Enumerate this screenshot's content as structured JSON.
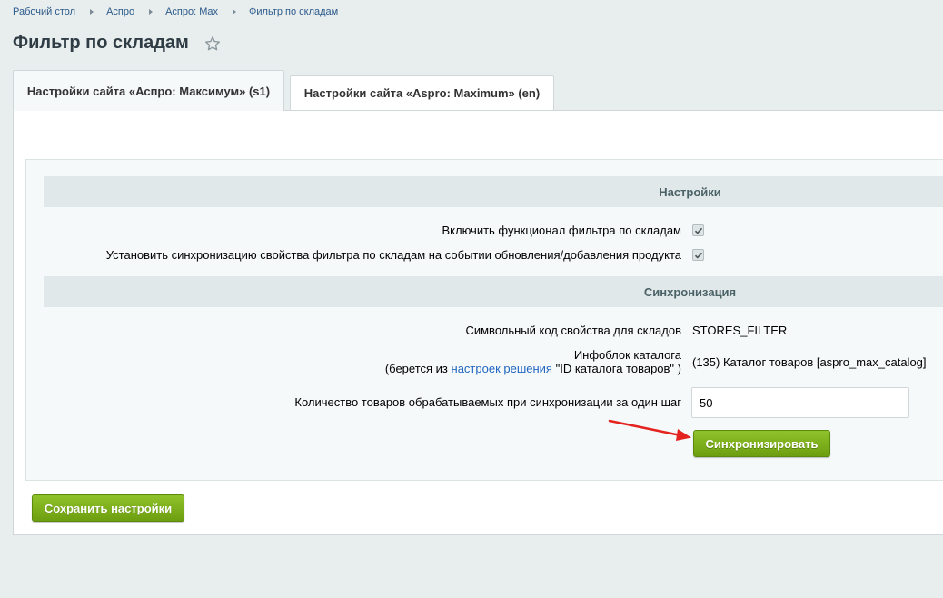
{
  "breadcrumbs": [
    "Рабочий стол",
    "Аспро",
    "Аспро: Max",
    "Фильтр по складам"
  ],
  "page_title": "Фильтр по складам",
  "tabs": [
    {
      "label": "Настройки сайта «Аспро: Максимум» (s1)",
      "active": true
    },
    {
      "label": "Настройки сайта «Aspro: Maximum» (en)",
      "active": false
    }
  ],
  "sections": {
    "settings": {
      "title": "Настройки",
      "enable_label": "Включить функционал фильтра по складам",
      "enable_checked": true,
      "sync_event_label": "Установить синхронизацию свойства фильтра по складам на событии обновления/добавления продукта",
      "sync_event_checked": true
    },
    "sync": {
      "title": "Синхронизация",
      "code_label": "Символьный код свойства для складов",
      "code_value": "STORES_FILTER",
      "iblock_label": "Инфоблок каталога",
      "iblock_hint_prefix": "(берется из",
      "iblock_hint_link": "настроек решения",
      "iblock_hint_suffix": "\"ID каталога товаров\" )",
      "iblock_value": "(135) Каталог товаров [aspro_max_catalog]",
      "count_label": "Количество товаров обрабатываемых при синхронизации за один шаг",
      "count_value": "50",
      "sync_button": "Синхронизировать"
    }
  },
  "save_button": "Сохранить настройки",
  "colors": {
    "accent_green": "#7aad18",
    "arrow_red": "#e4221f",
    "link_blue": "#2166c1"
  }
}
